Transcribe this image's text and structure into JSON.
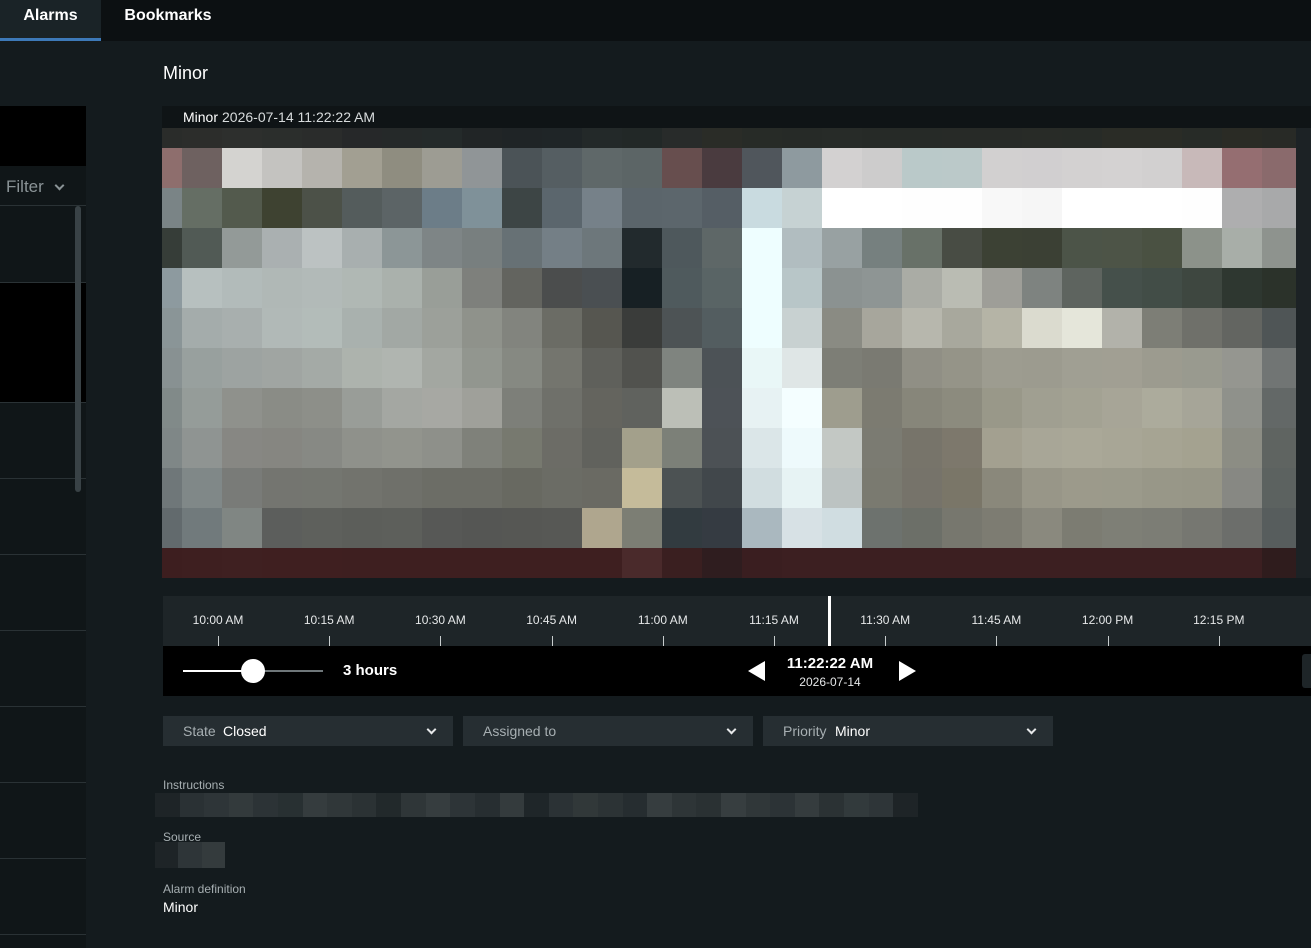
{
  "tabs": [
    {
      "label": "Alarms",
      "active": true
    },
    {
      "label": "Bookmarks",
      "active": false
    }
  ],
  "left_panel": {
    "filter_label": "Filter"
  },
  "alarm": {
    "title": "Minor",
    "video": {
      "camera_label": "Minor",
      "timestamp": "2026-07-14 11:22:22 AM"
    }
  },
  "timeline": {
    "ticks": [
      "10:00 AM",
      "10:15 AM",
      "10:30 AM",
      "10:45 AM",
      "11:00 AM",
      "11:15 AM",
      "11:30 AM",
      "11:45 AM",
      "12:00 PM",
      "12:15 PM"
    ],
    "span_label": "3 hours",
    "span_fraction": 0.5,
    "current_time": "11:22:22 AM",
    "current_date": "2026-07-14"
  },
  "fields": {
    "state": {
      "label": "State",
      "value": "Closed"
    },
    "assigned_to": {
      "label": "Assigned to",
      "value": ""
    },
    "priority": {
      "label": "Priority",
      "value": "Minor"
    }
  },
  "details": {
    "instructions_label": "Instructions",
    "source_label": "Source",
    "alarm_definition_label": "Alarm definition",
    "alarm_definition_value": "Minor"
  },
  "icons": {
    "filter_chevron": "chevron-down-icon",
    "prev": "triangle-left-icon",
    "next": "triangle-right-icon",
    "dropdown": "chevron-down-icon"
  },
  "colors": {
    "background": "#141b1e",
    "tab_bar": "#0c1012",
    "active_tab_underline": "#3d79b8",
    "dropdown_bg": "#262e32",
    "timeline_bg": "#1e2528",
    "controls_bg": "#000000"
  }
}
